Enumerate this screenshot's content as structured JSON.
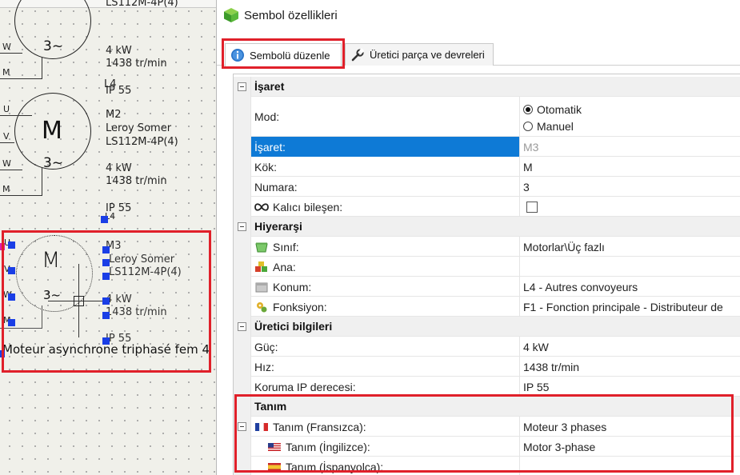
{
  "canvas": {
    "motor1": {
      "terminals": [
        "W",
        "M"
      ],
      "line1": "LS112M-4P(4)",
      "line2": "4 kW",
      "line3": "1438 tr/min",
      "line4": "L4",
      "line5": "IP 55",
      "phase": "3~"
    },
    "motor2": {
      "symbol": "M",
      "phase": "3~",
      "terminals": [
        "U",
        "V",
        "W",
        "M"
      ],
      "name": "M2",
      "maker": "Leroy Somer",
      "model": "LS112M-4P(4)",
      "power": "4 kW",
      "speed": "1438 tr/min",
      "ip": "IP 55",
      "tag": "L4"
    },
    "motor3": {
      "symbol": "M",
      "phase": "3~",
      "terminals": [
        "U",
        "V",
        "W",
        "M"
      ],
      "name": "M3",
      "maker": "Leroy Somer",
      "model": "LS112M-4P(4)",
      "power": "4 kW",
      "speed": "1438 tr/min",
      "ip": "IP 55",
      "description": "Moteur asynchrone triphasé fem 4"
    }
  },
  "window": {
    "title": "Sembol özellikleri",
    "tabs": [
      {
        "label": "Sembolü düzenle",
        "active": true
      },
      {
        "label": "Üretici parça ve devreleri",
        "active": false
      }
    ]
  },
  "grid": {
    "sections": {
      "isaret": "İşaret",
      "hiyerarsi": "Hiyerarşi",
      "uretici": "Üretici bilgileri",
      "tanim": "Tanım"
    },
    "mode_label": "Mod:",
    "mode_options": [
      "Otomatik",
      "Manuel"
    ],
    "mode_selected": "Otomatik",
    "isaret_label": "İşaret:",
    "isaret_value": "M3",
    "kok_label": "Kök:",
    "kok_value": "M",
    "numara_label": "Numara:",
    "numara_value": "3",
    "kalici_label": "Kalıcı bileşen:",
    "sinif_label": "Sınıf:",
    "sinif_value": "Motorlar\\Üç fazlı",
    "ana_label": "Ana:",
    "ana_value": "",
    "konum_label": "Konum:",
    "konum_value": "L4 - Autres convoyeurs",
    "fonksiyon_label": "Fonksiyon:",
    "fonksiyon_value": "F1 - Fonction principale - Distributeur de",
    "guc_label": "Güç:",
    "guc_value": "4 kW",
    "hiz_label": "Hız:",
    "hiz_value": "1438 tr/min",
    "ip_label": "Koruma IP derecesi:",
    "ip_value": "IP 55",
    "tanim_fr_label": "Tanım (Fransızca):",
    "tanim_fr_value": "Moteur 3 phases",
    "tanim_en_label": "Tanım (İngilizce):",
    "tanim_en_value": "Motor 3-phase",
    "tanim_es_label": "Tanım (İspanyolca):",
    "tanim_es_value": ""
  },
  "colors": {
    "highlight": "#0e7ad6",
    "annotation_frame": "#e0202a",
    "selection_handle": "#1a3ee6"
  }
}
